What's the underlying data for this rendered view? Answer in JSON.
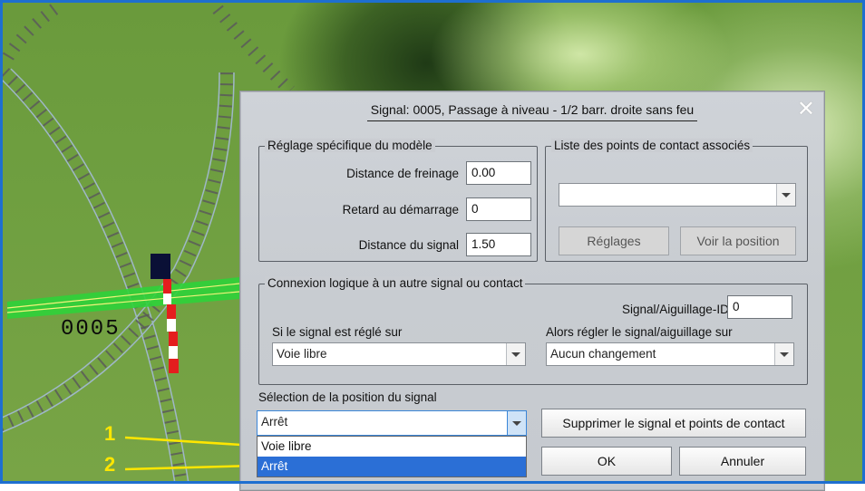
{
  "dialog": {
    "title": "Signal: 0005, Passage à niveau - 1/2 barr. droite sans feu",
    "close_glyph": "✕",
    "model_group": {
      "legend": "Réglage spécifique du modèle",
      "braking_label": "Distance de freinage",
      "braking_value": "0.00",
      "start_delay_label": "Retard au démarrage",
      "start_delay_value": "0",
      "signal_distance_label": "Distance du signal",
      "signal_distance_value": "1.50"
    },
    "contacts_group": {
      "legend": "Liste des points de contact associés",
      "combo_value": "",
      "settings_button": "Réglages",
      "view_position_button": "Voir la position"
    },
    "logic_group": {
      "legend": "Connexion logique à un autre signal ou contact",
      "signal_id_label": "Signal/Aiguillage-ID",
      "signal_id_value": "0",
      "if_label": "Si le signal est réglé sur",
      "if_value": "Voie libre",
      "then_label": "Alors régler le signal/aiguillage sur",
      "then_value": "Aucun changement"
    },
    "position": {
      "label": "Sélection de la position du signal",
      "current_value": "Arrêt",
      "options": [
        "Voie libre",
        "Arrêt"
      ],
      "highlighted_option": "Arrêt"
    },
    "delete_button": "Supprimer le signal et points de contact",
    "ok_button": "OK",
    "cancel_button": "Annuler"
  },
  "scene": {
    "track_label": "0005",
    "callouts": [
      "1",
      "2"
    ]
  },
  "colors": {
    "frame": "#1e6fd0",
    "callout": "#ffe600",
    "selection": "#2b6fd6",
    "grass": "#6f9f40"
  }
}
